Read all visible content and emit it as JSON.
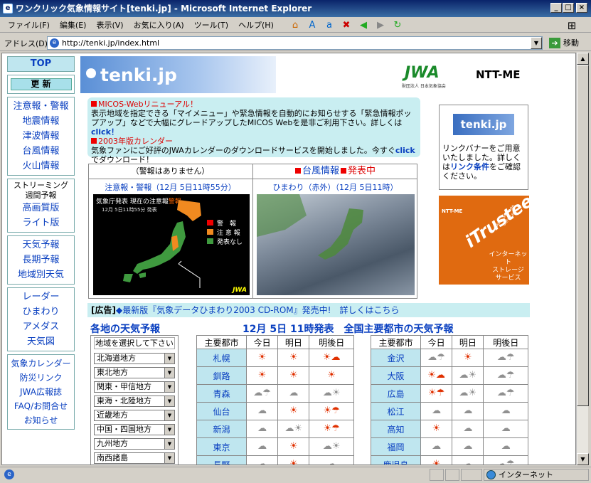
{
  "window": {
    "title": "ワンクリック気象情報サイト[tenki.jp] - Microsoft Internet Explorer"
  },
  "menu": [
    "ファイル(F)",
    "編集(E)",
    "表示(V)",
    "お気に入り(A)",
    "ツール(T)",
    "ヘルプ(H)"
  ],
  "address": {
    "label": "アドレス(D)",
    "url": "http://tenki.jp/index.html",
    "go": "移動"
  },
  "status": {
    "zone": "インターネット"
  },
  "nav": {
    "top": "TOP",
    "update": "更 新",
    "group1": [
      "注意報・警報",
      "地震情報",
      "津波情報",
      "台風情報",
      "火山情報"
    ],
    "group2_small": "ストリーミング\n週間予報",
    "group2": [
      "高画質版",
      "ライト版"
    ],
    "group3": [
      "天気予報",
      "長期予報",
      "地域別天気"
    ],
    "group4": [
      "レーダー",
      "ひまわり",
      "アメダス",
      "天気図"
    ],
    "group5": [
      "気象カレンダー",
      "防災リンク",
      "JWA広報誌",
      "FAQ/お問合せ",
      "お知らせ"
    ]
  },
  "header": {
    "logo": "tenki.jp",
    "jwa": "JWA",
    "jwa_sub": "財団法人 日本気象協会",
    "ntt": "NTT-ME"
  },
  "news": {
    "h1": "MICOS-Webリニューアル！",
    "b1": "表示地域を指定できる「マイメニュー」や緊急情報を自動的にお知らせする「緊急情報ポップアップ」などで大幅にグレードアップしたMICOS Webを是非ご利用下さい。詳しくは",
    "h2": "2003年版カレンダー",
    "b2": "気象ファンにご好評のJWAカレンダーのダウンロードサービスを開始しました。今すぐ",
    "b2_end": "でダウンロード！",
    "click": "click",
    "click1": "click！"
  },
  "panes": {
    "warn_head": "（警報はありません）",
    "typhoon": "台風情報",
    "typhoon_status": "発表中",
    "warn_cap": "注意報・警報（12月 5日11時55分）",
    "sat_cap": "ひまわり（赤外）（12月 5日11時）",
    "map_title": "気象庁発表 現在の注意報",
    "map_title2": "警報",
    "map_date": "12月 5日11時55分 発表",
    "legend": [
      "警　報",
      "注 意 報",
      "発表なし"
    ],
    "jwa_mark": "JWA"
  },
  "ad": {
    "label": "[広告]",
    "text": "◆最新版『気象データひまわり2003 CD-ROM』発売中!　詳しくはこちら"
  },
  "side": {
    "logo": "tenki.jp",
    "text1": "リンクバナーをご用意いたしました。詳しくは",
    "link": "リンク条件",
    "text2": "をご確認ください。",
    "tr_brand": "NTT-ME",
    "tr_name": "iTrustee",
    "tr_sub": "Data Storage Service",
    "tr_lines": [
      "インターネット",
      "ストレージ",
      "サービス"
    ]
  },
  "regions": {
    "title": "各地の天気予報",
    "caption": "地域を選択して下さい",
    "items": [
      "北海道地方",
      "東北地方",
      "関東・甲信地方",
      "東海・北陸地方",
      "近畿地方",
      "中国・四国地方",
      "九州地方",
      "南西諸島"
    ]
  },
  "forecast": {
    "title_date": "12月 5日",
    "title": "11時発表　全国主要都市の天気予報",
    "headers": [
      "主要都市",
      "今日",
      "明日",
      "明後日"
    ],
    "left": [
      {
        "city": "札幌",
        "w": [
          "sun",
          "sun",
          "sun-cloud"
        ]
      },
      {
        "city": "釧路",
        "w": [
          "sun",
          "sun",
          "sun"
        ]
      },
      {
        "city": "青森",
        "w": [
          "cloud-rain",
          "cloud",
          "cloud-sun"
        ]
      },
      {
        "city": "仙台",
        "w": [
          "cloud",
          "sun",
          "sun-rain"
        ]
      },
      {
        "city": "新潟",
        "w": [
          "cloud",
          "cloud-sun",
          "sun-rain"
        ]
      },
      {
        "city": "東京",
        "w": [
          "cloud",
          "sun",
          "cloud-sun"
        ]
      },
      {
        "city": "長野",
        "w": [
          "cloud",
          "sun",
          "cloud"
        ]
      }
    ],
    "right": [
      {
        "city": "金沢",
        "w": [
          "cloud-rain",
          "sun",
          "cloud-rain"
        ]
      },
      {
        "city": "大阪",
        "w": [
          "sun-cloud",
          "cloud-sun",
          "cloud-rain"
        ]
      },
      {
        "city": "広島",
        "w": [
          "sun-rain",
          "cloud-sun",
          "cloud-rain"
        ]
      },
      {
        "city": "松江",
        "w": [
          "cloud",
          "cloud",
          "cloud"
        ]
      },
      {
        "city": "高知",
        "w": [
          "sun",
          "cloud",
          "cloud"
        ]
      },
      {
        "city": "福岡",
        "w": [
          "cloud",
          "cloud",
          "cloud"
        ]
      },
      {
        "city": "鹿児島",
        "w": [
          "sun",
          "cloud",
          "cloud-rain"
        ]
      }
    ]
  }
}
